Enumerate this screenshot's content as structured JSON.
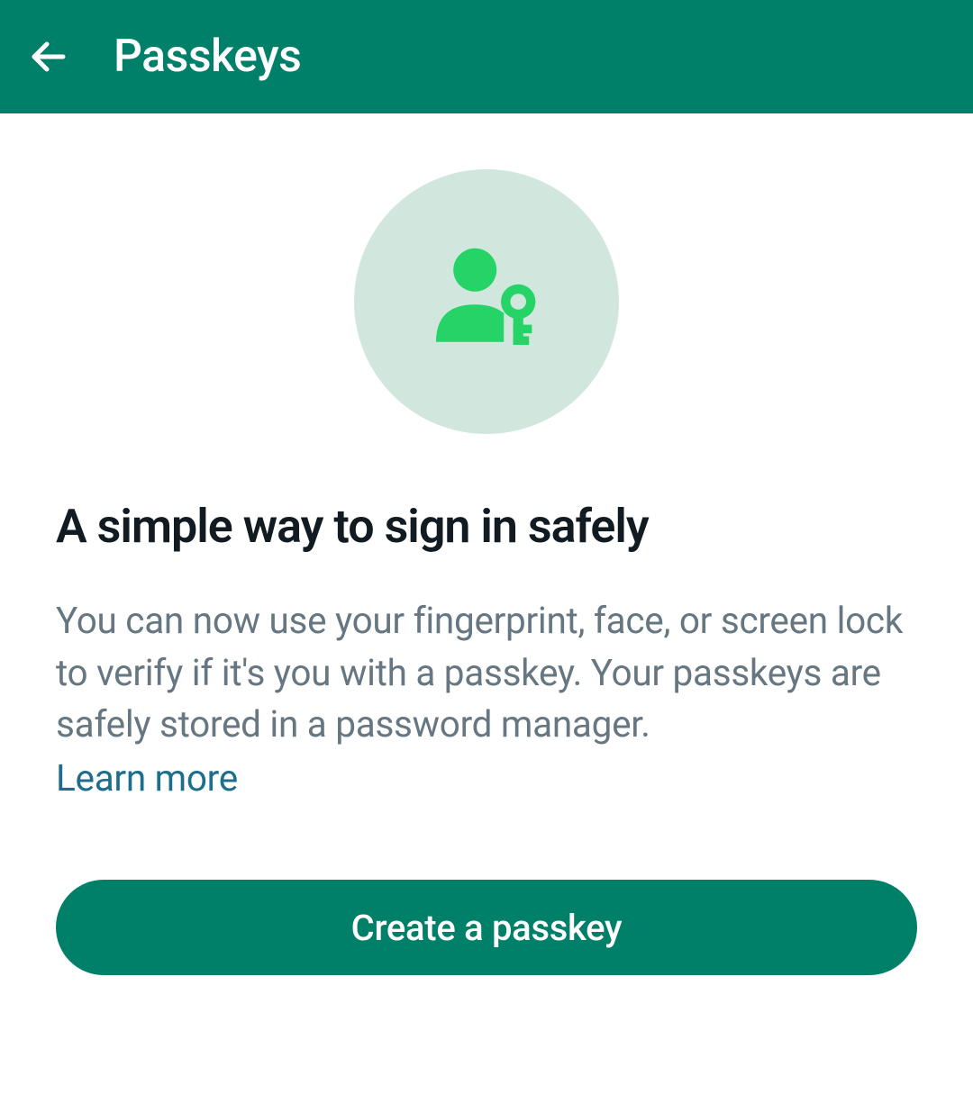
{
  "header": {
    "title": "Passkeys"
  },
  "content": {
    "heading": "A simple way to sign in safely",
    "description": "You can now use your fingerprint, face, or screen lock to verify if it's you with a passkey. Your passkeys are safely stored in a password manager.",
    "learn_more_label": "Learn more",
    "create_button_label": "Create a passkey"
  },
  "colors": {
    "primary": "#008069",
    "icon_bg": "#d1e7dd",
    "icon_fg": "#25d366",
    "text_primary": "#111b21",
    "text_secondary": "#667781",
    "link": "#1c6e8c"
  }
}
